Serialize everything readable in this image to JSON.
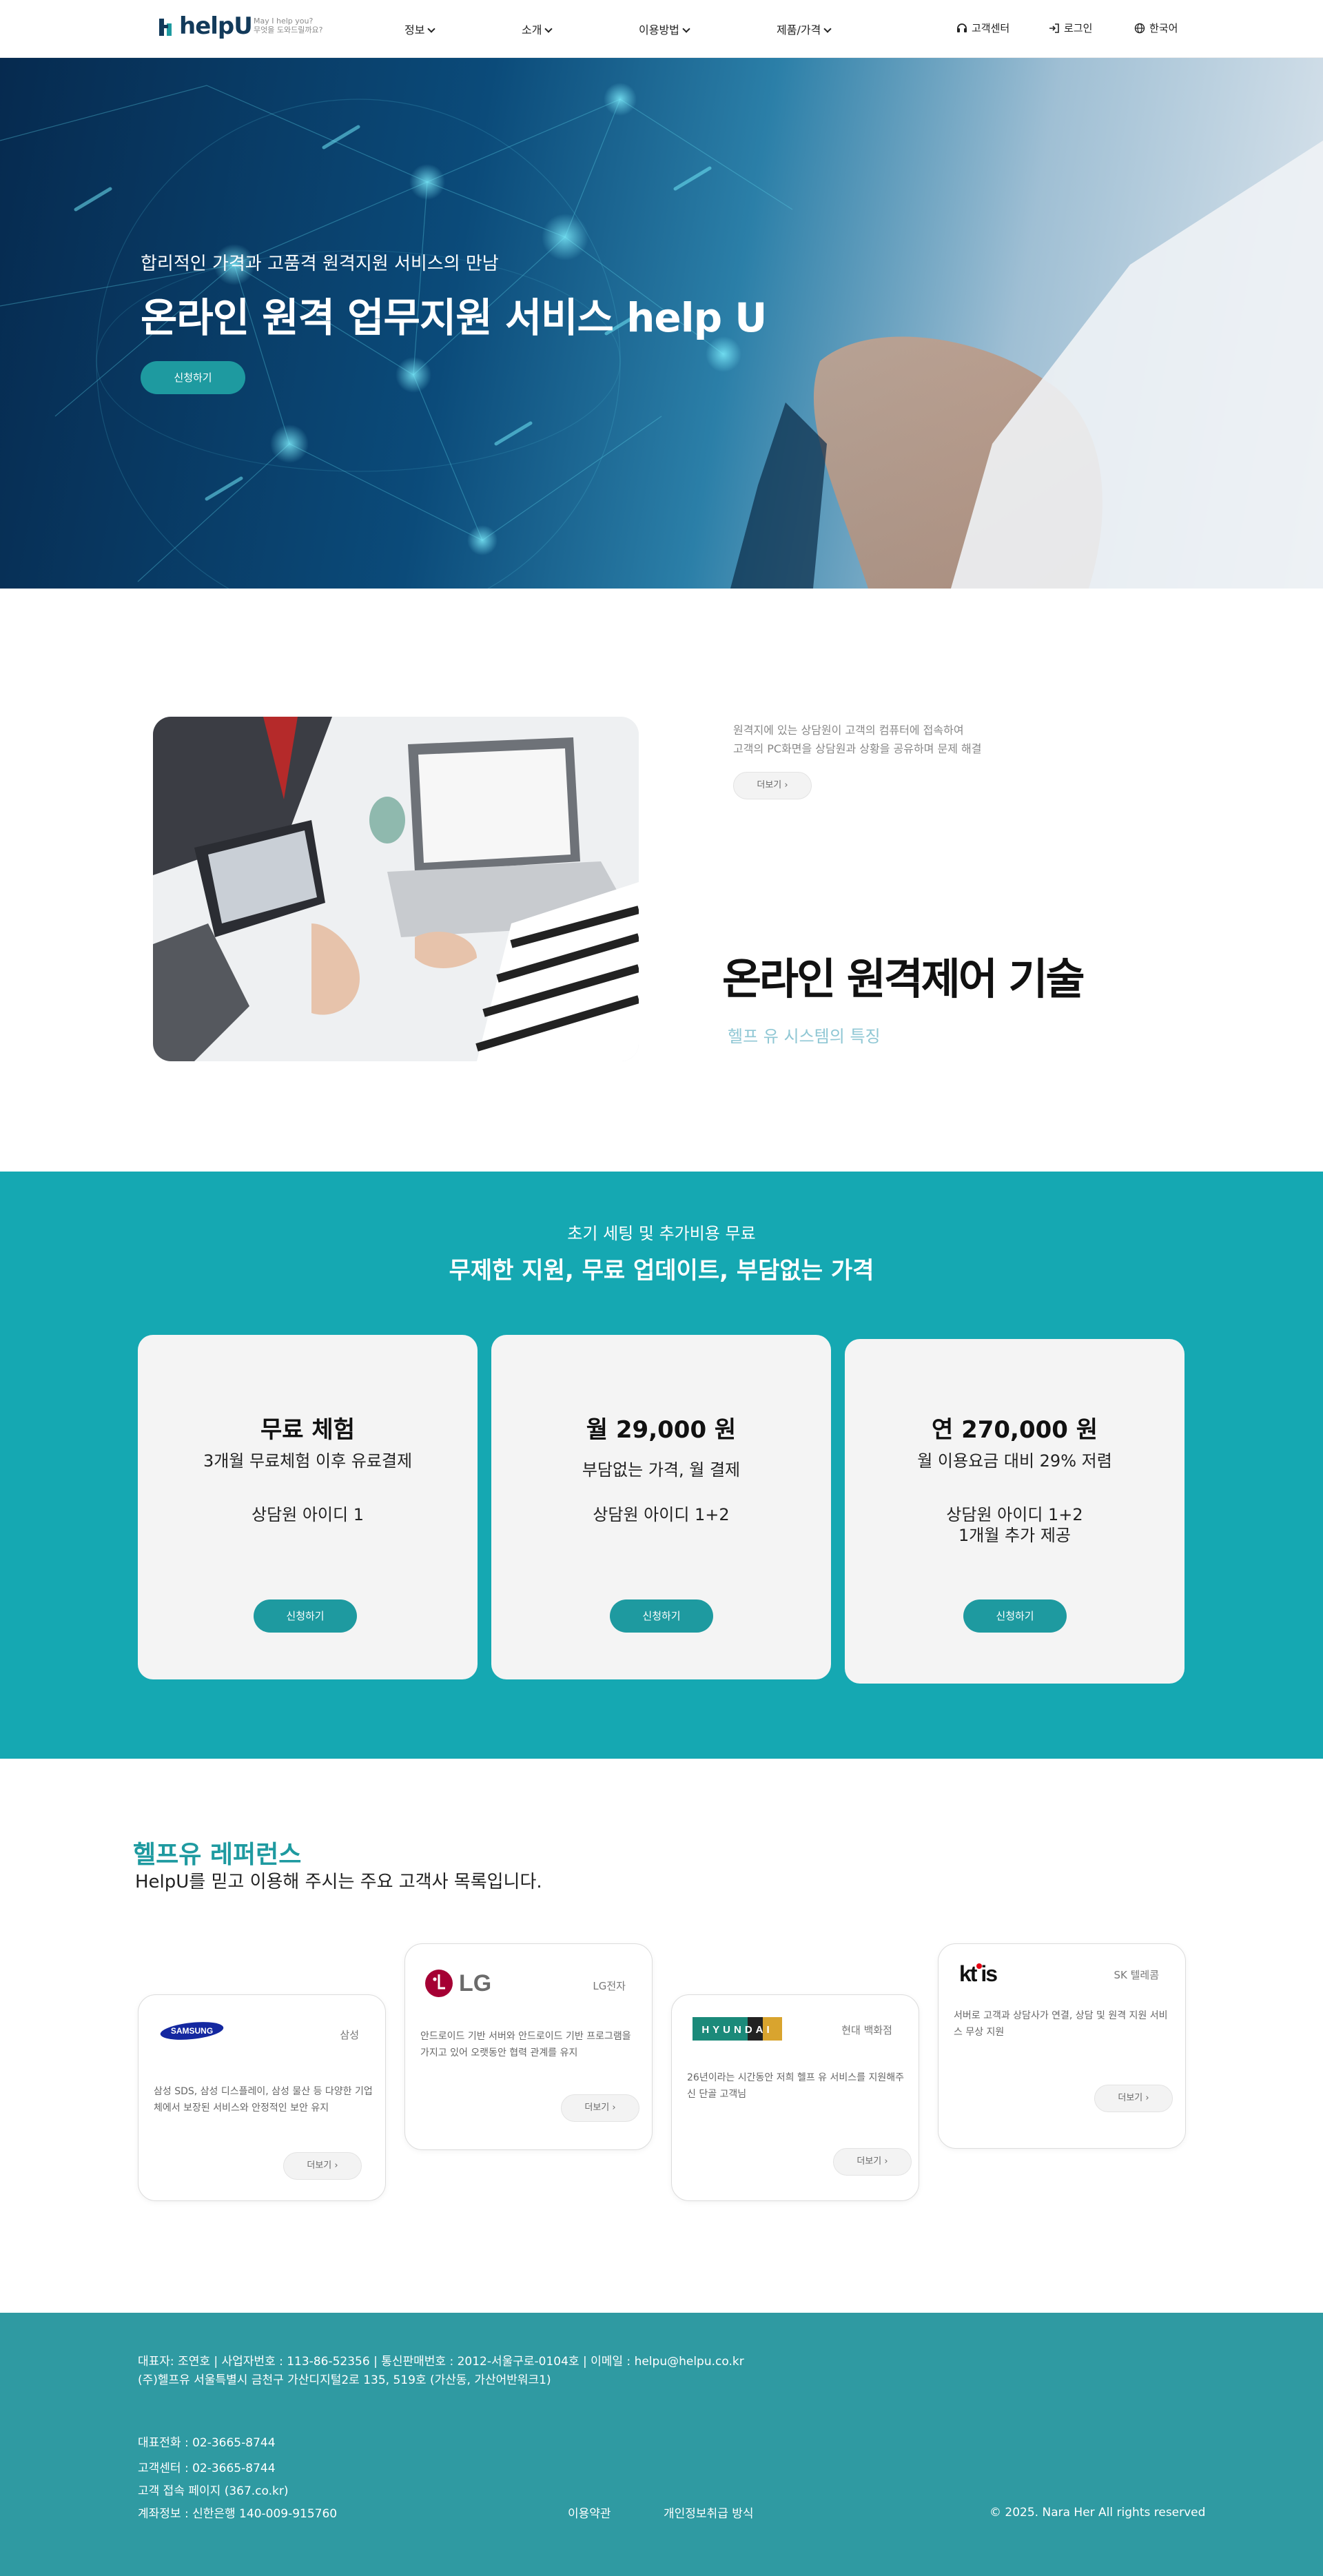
{
  "header": {
    "logo_text": "helpU",
    "logo_sub_1": "May I help you?",
    "logo_sub_2": "무엇을 도와드릴까요?",
    "nav": [
      {
        "label": "정보"
      },
      {
        "label": "소개"
      },
      {
        "label": "이용방법"
      },
      {
        "label": "제품/가격"
      }
    ],
    "utils": {
      "support": "고객센터",
      "login": "로그인",
      "language": "한국어"
    }
  },
  "hero": {
    "subtitle": "합리적인 가격과 고품격 원격지원 서비스의 만남",
    "title": "온라인 원격 업무지원 서비스 help U",
    "cta": "신청하기"
  },
  "feature": {
    "desc_line1": "원격지에 있는 상담원이 고객의 컴퓨터에 접속하여",
    "desc_line2": "고객의 PC화면을 상담원과 상황을 공유하며 문제 해결",
    "more": "더보기",
    "title": "온라인 원격제어 기술",
    "subtitle": "헬프 유 시스템의 특징"
  },
  "pricing": {
    "subtitle": "초기 세팅 및 추가비용 무료",
    "title": "무제한 지원, 무료 업데이트, 부담없는 가격",
    "plans": [
      {
        "title": "무료 체험",
        "line1": "3개월 무료체험 이후 유료결제",
        "line2": "상담원 아이디 1",
        "line3": "",
        "cta": "신청하기"
      },
      {
        "title": "월 29,000 원",
        "line1": "부담없는 가격, 월 결제",
        "line2": "상담원 아이디 1+2",
        "line3": "",
        "cta": "신청하기"
      },
      {
        "title": "연 270,000 원",
        "line1": "월 이용요금 대비 29% 저렴",
        "line2": "상담원 아이디 1+2",
        "line3": "1개월 추가 제공",
        "cta": "신청하기"
      }
    ]
  },
  "references": {
    "title": "헬프유 레퍼런스",
    "subtitle": "HelpU를 믿고 이용해 주시는 주요 고객사 목록입니다.",
    "clients": [
      {
        "logo": "SAMSUNG",
        "name": "삼성",
        "desc": "삼성 SDS, 삼성 디스플레이, 삼성 물산 등 다양한 기업체에서 보장된 서비스와 안정적인 보안 유지",
        "more": "더보기"
      },
      {
        "logo": "LG",
        "name": "LG전자",
        "desc": "안드로이드 기반 서버와 안드로이드 기반 프로그램을 가지고 있어 오랫동안 협력 관계를 유지",
        "more": "더보기"
      },
      {
        "logo": "HYUNDAI",
        "name": "현대 백화점",
        "desc": "26년이라는 시간동안 저희 헬프 유 서비스를 지원해주신 단골 고객님",
        "more": "더보기"
      },
      {
        "logo": "kt is",
        "name": "SK 텔레콤",
        "desc": "서버로 고객과 상담사가 연결, 상담 및 원격 지원 서비스 무상 지원",
        "more": "더보기"
      }
    ]
  },
  "footer": {
    "company_line": "대표자: 조연호 | 사업자번호 : 113-86-52356 | 통신판매번호 : 2012-서울구로-0104호 | 이메일 : helpu@helpu.co.kr",
    "address_line": "(주)헬프유 서울특별시 금천구 가산디지털2로 135, 519호 (가산동, 가산어반워크1)",
    "phone": "대표전화 : 02-3665-8744",
    "support_phone": "고객센터 : 02-3665-8744",
    "access_page": "고객 접속 페이지 (367.co.kr)",
    "account": "계좌정보 : 신한은행 140-009-915760",
    "terms": "이용약관",
    "privacy": "개인정보취급 방식",
    "copyright": "© 2025. Nara Her All rights reserved"
  },
  "colors": {
    "accent": "#1e9aa0",
    "pricing_bg": "#15a8b2",
    "footer_bg": "#2f9aa2",
    "brand_navy": "#123a5a"
  }
}
